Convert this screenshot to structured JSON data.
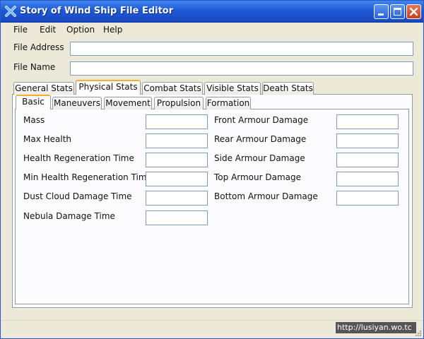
{
  "window": {
    "title": "Story of Wind Ship File Editor",
    "icon": "app-x-icon",
    "controls": [
      "minimize-icon",
      "maximize-icon",
      "close-icon"
    ]
  },
  "menu": {
    "file": "File",
    "edit": "Edit",
    "option": "Option",
    "help": "Help"
  },
  "form": {
    "file_address_label": "File Address",
    "file_address_value": "",
    "file_name_label": "File Name",
    "file_name_value": ""
  },
  "main_tabs": {
    "general": "General Stats",
    "physical": "Physical Stats",
    "combat": "Combat Stats",
    "visible": "Visible Stats",
    "death": "Death Stats",
    "selected": "Physical Stats"
  },
  "sub_tabs": {
    "basic": "Basic",
    "maneuvers": "Maneuvers",
    "movement": "Movement",
    "propulsion": "Propulsion",
    "formation": "Formation",
    "selected": "Basic"
  },
  "left_fields": {
    "mass": "Mass",
    "max_health": "Max Health",
    "health_regen": "Health Regeneration Time",
    "min_health_regen": "Min Health Regeneration Time",
    "dust_cloud": "Dust Cloud Damage Time",
    "nebula": "Nebula Damage Time"
  },
  "right_fields": {
    "front_armour": "Front Armour Damage",
    "rear_armour": "Rear Armour Damage",
    "side_armour": "Side Armour Damage",
    "top_armour": "Top Armour Damage",
    "bottom_armour": "Bottom Armour Damage"
  },
  "status": {
    "watermark": "http://lusiyan.wo.tc"
  },
  "colors": {
    "titlebar": "#1f59d6",
    "window_bg": "#ece9d8",
    "selected_tab_accent": "#f0b030"
  }
}
